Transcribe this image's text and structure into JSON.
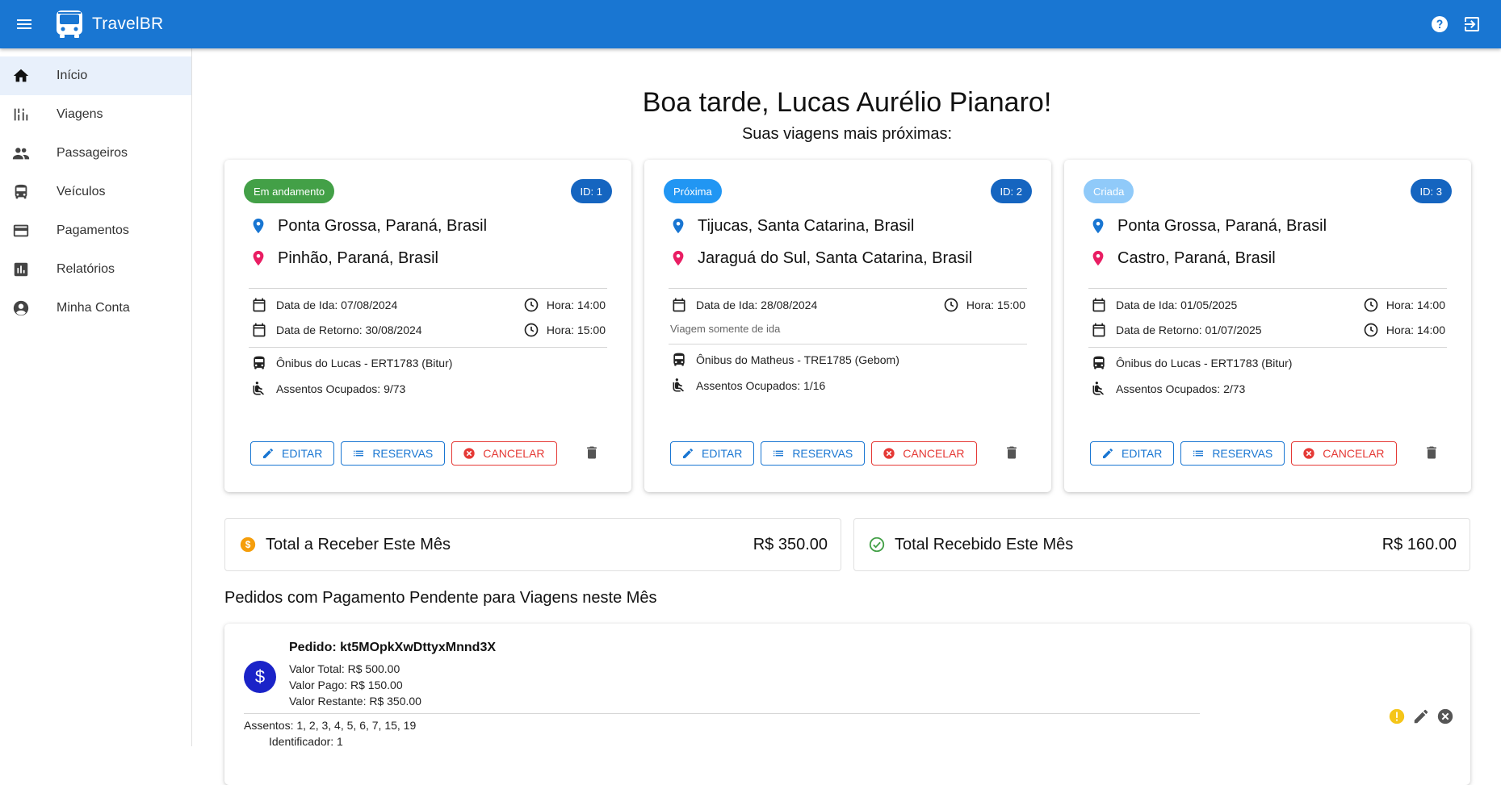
{
  "app": {
    "title": "TravelBR",
    "colors": {
      "primary": "#1976d2",
      "success": "#43a047",
      "info": "#2196f3",
      "danger": "#e53935"
    }
  },
  "appbar": {
    "icons": [
      "menu-icon",
      "bus-logo-icon",
      "help-icon",
      "logout-icon"
    ]
  },
  "sidebar": {
    "items": [
      {
        "label": "Início",
        "icon": "home-icon"
      },
      {
        "label": "Viagens",
        "icon": "routes-icon"
      },
      {
        "label": "Passageiros",
        "icon": "people-icon"
      },
      {
        "label": "Veículos",
        "icon": "bus-icon"
      },
      {
        "label": "Pagamentos",
        "icon": "credit-card-icon"
      },
      {
        "label": "Relatórios",
        "icon": "bar-chart-icon"
      },
      {
        "label": "Minha Conta",
        "icon": "account-icon"
      }
    ]
  },
  "main": {
    "greeting": "Boa tarde, Lucas Aurélio Pianaro!",
    "subtitle": "Suas viagens mais próximas:",
    "trips": [
      {
        "status": "Em andamento",
        "status_color": "#43a047",
        "id": "ID: 1",
        "origin": "Ponta Grossa, Paraná, Brasil",
        "destination": "Pinhão, Paraná, Brasil",
        "departure": "Data de Ida: 07/08/2024",
        "departure_time": "Hora: 14:00",
        "return": "Data de Retorno: 30/08/2024",
        "return_time": "Hora: 15:00",
        "vehicle": "Ônibus do Lucas - ERT1783 (Bitur)",
        "seats": "Assentos Ocupados: 9/73"
      },
      {
        "status": "Próxima",
        "status_color": "#2196f3",
        "id": "ID: 2",
        "origin": "Tijucas, Santa Catarina, Brasil",
        "destination": "Jaraguá do Sul, Santa Catarina, Brasil",
        "departure": "Data de Ida: 28/08/2024",
        "departure_time": "Hora: 15:00",
        "note": "Viagem somente de ida",
        "vehicle": "Ônibus do Matheus - TRE1785 (Gebom)",
        "seats": "Assentos Ocupados: 1/16"
      },
      {
        "status": "Criada",
        "status_color": "#90caf9",
        "id": "ID: 3",
        "origin": "Ponta Grossa, Paraná, Brasil",
        "destination": "Castro, Paraná, Brasil",
        "departure": "Data de Ida: 01/05/2025",
        "departure_time": "Hora: 14:00",
        "return": "Data de Retorno: 01/07/2025",
        "return_time": "Hora: 14:00",
        "vehicle": "Ônibus do Lucas - ERT1783 (Bitur)",
        "seats": "Assentos Ocupados: 2/73"
      }
    ],
    "buttons": {
      "edit": "EDITAR",
      "reservations": "RESERVAS",
      "cancel": "CANCELAR"
    },
    "totals": {
      "to_receive_label": "Total a Receber Este Mês",
      "to_receive_value": "R$ 350.00",
      "received_label": "Total Recebido Este Mês",
      "received_value": "R$ 160.00"
    },
    "pending_title": "Pedidos com Pagamento Pendente para Viagens neste Mês",
    "order": {
      "avatar": "$",
      "id": "Pedido: kt5MOpkXwDttyxMnnd3X",
      "total": "Valor Total: R$ 500.00",
      "paid": "Valor Pago: R$ 150.00",
      "remaining": "Valor Restante: R$ 350.00",
      "seats": "Assentos: 1, 2, 3, 4, 5, 6, 7, 15, 19",
      "identifier": "Identificador: 1"
    }
  }
}
